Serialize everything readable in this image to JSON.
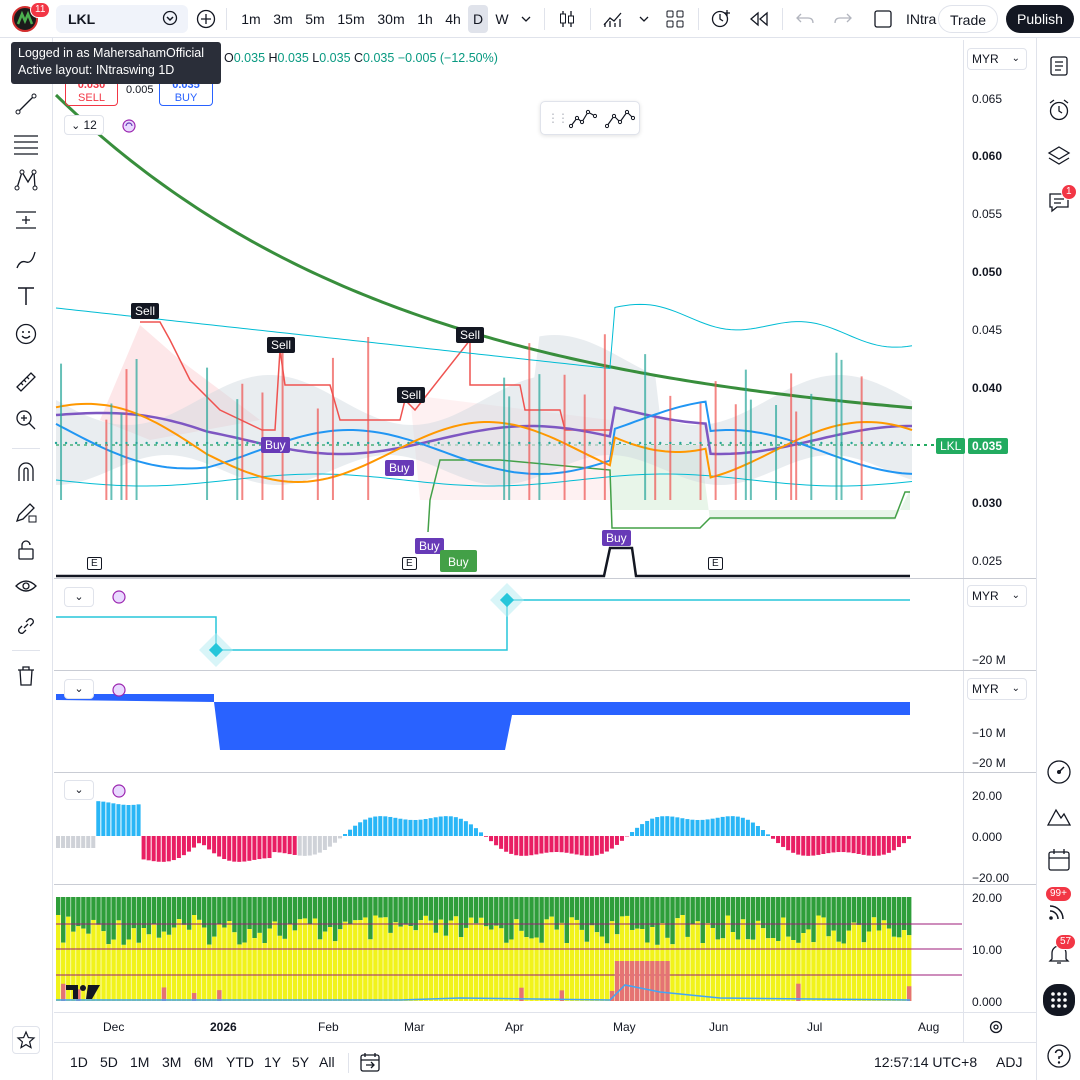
{
  "topbar": {
    "avatar_badge": "11",
    "symbol": "LKL",
    "intervals": [
      "1m",
      "3m",
      "5m",
      "15m",
      "30m",
      "1h",
      "4h",
      "D",
      "W"
    ],
    "active_interval": "D",
    "layout_name": "INtra",
    "trade_label": "Trade",
    "publish_label": "Publish"
  },
  "tooltip": {
    "line1": "Logged in as MahersahamOfficial",
    "line2": "Active layout: INtraswing 1D"
  },
  "legend": {
    "o_label": "O",
    "o_value": "0.035",
    "h_label": "H",
    "h_value": "0.035",
    "l_label": "L",
    "l_value": "0.035",
    "c_label": "C",
    "c_value": "0.035",
    "change": "−0.005 (−12.50%)",
    "sell_price": "0.030",
    "sell_label": "SELL",
    "spread": "0.005",
    "buy_price": "0.035",
    "buy_label": "BUY",
    "indicator_count": "12"
  },
  "currency": "MYR",
  "price_axis": [
    "0.065",
    "0.060",
    "0.055",
    "0.050",
    "0.045",
    "0.040",
    "0.035",
    "0.030",
    "0.025"
  ],
  "last_price_tag": {
    "symbol": "LKL",
    "price": "0.035"
  },
  "signals": {
    "sell": "Sell",
    "buy": "Buy",
    "earnings": "E"
  },
  "pane2_axis": [
    "−20 M"
  ],
  "pane3_axis": [
    "−10 M",
    "−20 M"
  ],
  "pane4_axis": [
    "20.00",
    "0.000",
    "−20.00"
  ],
  "pane5_axis": [
    "20.00",
    "10.00",
    "0.000"
  ],
  "time_axis": [
    "Dec",
    "2026",
    "Feb",
    "Mar",
    "Apr",
    "May",
    "Jun",
    "Jul",
    "Aug"
  ],
  "bottombar": {
    "ranges": [
      "1D",
      "5D",
      "1M",
      "3M",
      "6M",
      "YTD",
      "1Y",
      "5Y",
      "All"
    ],
    "clock": "12:57:14 UTC+8",
    "adj": "ADJ"
  },
  "rightbar": {
    "chat_badge": "1",
    "stream_badge": "99+",
    "alerts_badge": "57"
  },
  "colors": {
    "accent": "#131722",
    "green": "#089981",
    "red": "#f23645",
    "blue": "#2962ff",
    "ema": "#388e3c"
  }
}
